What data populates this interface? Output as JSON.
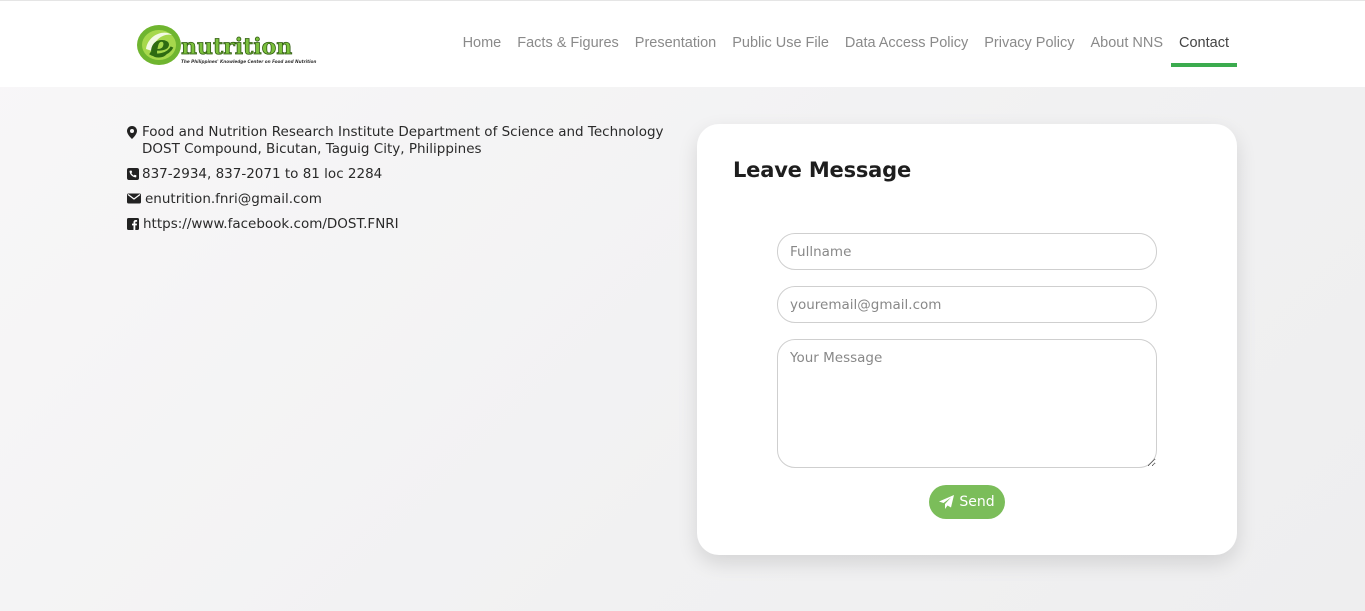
{
  "header": {
    "logo": {
      "letter": "e",
      "wordmark": "nutrition",
      "tagline": "The Philippines' Knowledge Center on Food and Nutrition",
      "colors": {
        "green": "#5aa832",
        "light_green": "#9fd34a",
        "dark": "#2a4d14"
      }
    },
    "nav": [
      {
        "label": "Home",
        "active": false
      },
      {
        "label": "Facts & Figures",
        "active": false
      },
      {
        "label": "Presentation",
        "active": false
      },
      {
        "label": "Public Use File",
        "active": false
      },
      {
        "label": "Data Access Policy",
        "active": false
      },
      {
        "label": "Privacy Policy",
        "active": false
      },
      {
        "label": "About NNS",
        "active": false
      },
      {
        "label": "Contact",
        "active": true
      }
    ],
    "active_color": "#3bab4e"
  },
  "contact": {
    "address_line1": "Food and Nutrition Research Institute Department of Science and Technology",
    "address_line2": "DOST Compound, Bicutan, Taguig City, Philippines",
    "phone": "837-2934, 837-2071 to 81 loc 2284",
    "email": "enutrition.fnri@gmail.com",
    "facebook": "https://www.facebook.com/DOST.FNRI",
    "icons": [
      "map-marker-icon",
      "phone-icon",
      "envelope-icon",
      "facebook-icon"
    ]
  },
  "form": {
    "title": "Leave Message",
    "fullname_placeholder": "Fullname",
    "email_placeholder": "youremail@gmail.com",
    "message_placeholder": "Your Message",
    "send_label": "Send",
    "send_color": "#7bbd5a"
  }
}
